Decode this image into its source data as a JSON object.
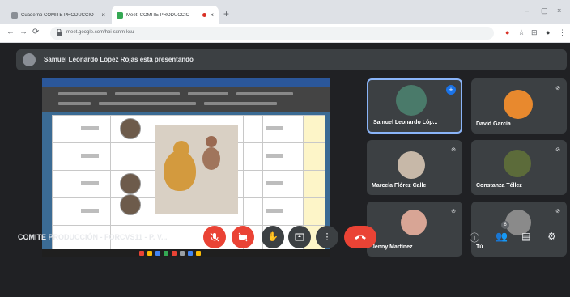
{
  "browser": {
    "tabs": [
      {
        "label": "Cuaderno COMITE PRODUCCIO",
        "close": "×",
        "color": "#8a8f96"
      },
      {
        "label": "Meet: COMITE PRODUCCIO",
        "close": "×",
        "color": "#34a853"
      }
    ],
    "new_tab": "+",
    "window_controls": [
      "–",
      "▢",
      "×"
    ],
    "url": "meet.google.com/hbi-sxnm-ksu",
    "nav": [
      "←",
      "→",
      "⟳"
    ],
    "toolbar_icons": [
      "●",
      "☆",
      "⊞",
      "●",
      "⋮"
    ]
  },
  "meet": {
    "presenting_banner": "Samuel Leonardo Lopez Rojas está presentando",
    "meeting_title": "COMITE PRODUCCIÓN - FORCVS11 - P. V...",
    "participants": [
      {
        "name": "Samuel Leonardo Lóp...",
        "color": "#4a7a6a"
      },
      {
        "name": "David García",
        "color": "#e8892e"
      },
      {
        "name": "Marcela Flórez Calle",
        "color": "#c7b8a8"
      },
      {
        "name": "Constanza Téllez",
        "color": "#5c6b3a"
      },
      {
        "name": "Jenny Martínez",
        "color": "#d8a595"
      },
      {
        "name": "Tú",
        "color": "#8a8a8a"
      }
    ],
    "people_count": "6",
    "colors": {
      "accent": "#8ab4f8",
      "danger": "#ea4335",
      "bg": "#202124",
      "tile": "#3c4043"
    }
  }
}
